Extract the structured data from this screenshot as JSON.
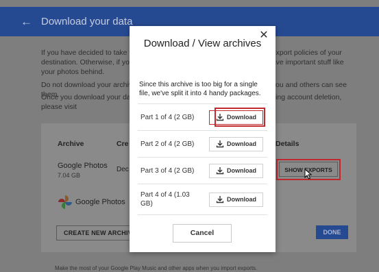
{
  "header": {
    "back_icon": "arrow-left-icon",
    "title": "Download your data"
  },
  "background": {
    "para1": "If you have decided to take your data elsewhere, please review the data export policies of your destination. Otherwise, if you are deleting your account, be sure not to leave important stuff like your photos behind.",
    "para2": "Do not download your archive on public computers and ensure that only you and others can see them.",
    "para3": "Once you download your data, you can delete it from your account, including account deletion, please visit",
    "columns": {
      "archive": "Archive",
      "created": "Cre",
      "details": "Details"
    },
    "row": {
      "name": "Google Photos",
      "size": "7.04 GB",
      "created": "Dec"
    },
    "logo_label": "Google Photos",
    "create_button": "CREATE NEW ARCHIVE",
    "show_exports_button": "SHOW EXPORTS",
    "done_button": "DONE",
    "footer_text": "Make the most of your Google Play Music and other apps when you import exports."
  },
  "modal": {
    "title": "Download / View archives",
    "close_icon": "close-icon",
    "description": "Since this archive is too big for a single file, we've split it into 4 handy packages.",
    "packages": [
      {
        "label": "Part 1 of 4 (2 GB)",
        "button": "Download"
      },
      {
        "label": "Part 2 of 4 (2 GB)",
        "button": "Download"
      },
      {
        "label": "Part 3 of 4 (2 GB)",
        "button": "Download"
      },
      {
        "label": "Part 4 of 4 (1.03 GB)",
        "button": "Download"
      }
    ],
    "cancel": "Cancel"
  },
  "colors": {
    "accent": "#264a91",
    "highlight": "#c0282e"
  }
}
